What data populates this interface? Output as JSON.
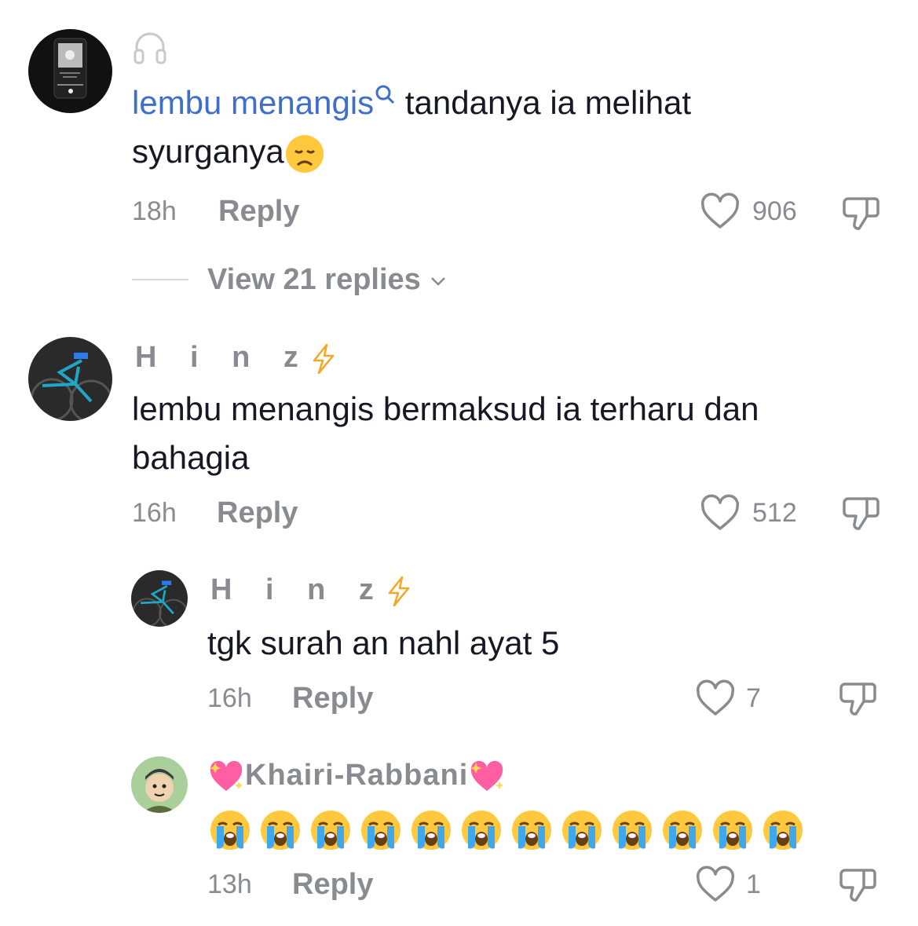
{
  "comments": [
    {
      "text_link": "lembu menangis",
      "text_rest": " tandanya ia melihat",
      "text_line2": "syurganya",
      "time": "18h",
      "reply_label": "Reply",
      "likes": "906",
      "view_replies": "View 21 replies"
    },
    {
      "username": "H i n z",
      "text": "lembu menangis bermaksud ia terharu dan",
      "text_line2": "bahagia",
      "time": "16h",
      "reply_label": "Reply",
      "likes": "512"
    }
  ],
  "replies": [
    {
      "username": "H i n z",
      "text": "tgk surah an nahl ayat 5",
      "time": "16h",
      "reply_label": "Reply",
      "likes": "7"
    },
    {
      "username": "Khairi-Rabbani",
      "time": "13h",
      "reply_label": "Reply",
      "likes": "1",
      "emoji_count": 12
    }
  ],
  "colors": {
    "link": "#3f6ecb",
    "muted": "#8a8b91",
    "text": "#161823",
    "lightning": "#f5a623",
    "heart_emoji": "#ff5fa2"
  },
  "icons": [
    "headphones-icon",
    "search-icon",
    "disappointed-face-emoji",
    "heart-outline-icon",
    "dislike-icon",
    "chevron-down-icon",
    "lightning-icon",
    "sparkling-heart-emoji",
    "loudly-crying-face-emoji"
  ]
}
